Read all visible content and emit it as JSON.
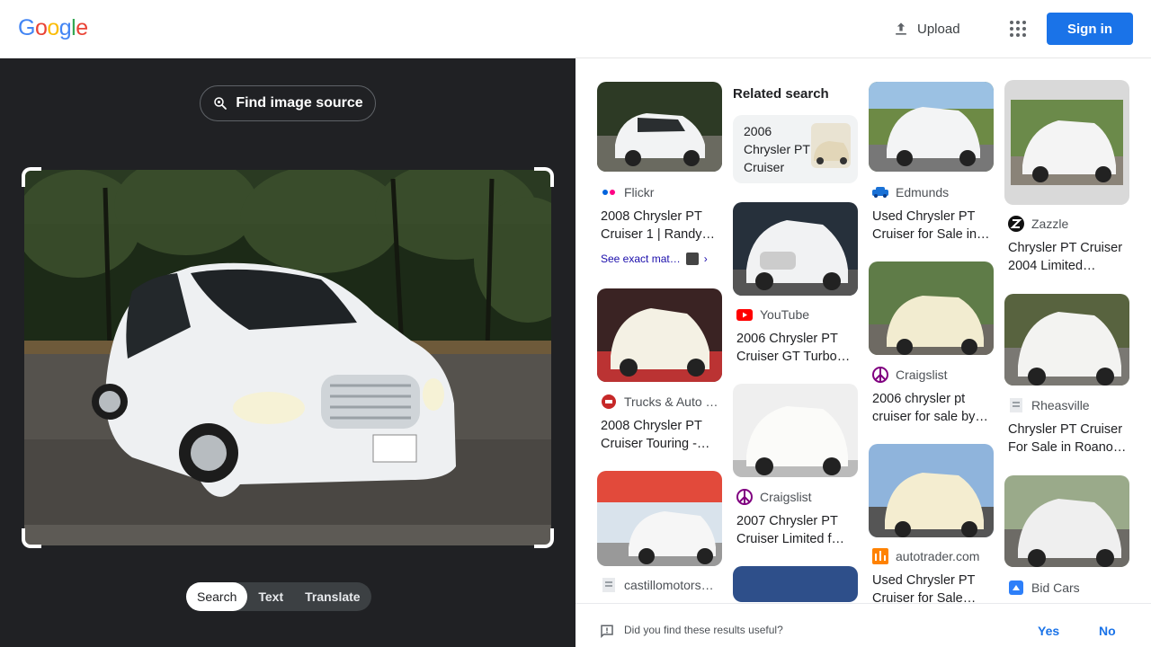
{
  "header": {
    "logo": [
      "G",
      "o",
      "o",
      "g",
      "l",
      "e"
    ],
    "logo_colors": [
      "#4285F4",
      "#EA4335",
      "#FBBC05",
      "#4285F4",
      "#34A853",
      "#EA4335"
    ],
    "upload_label": "Upload",
    "signin_label": "Sign in"
  },
  "lens": {
    "find_source_label": "Find image source",
    "modes": [
      "Search",
      "Text",
      "Translate"
    ],
    "active_mode": "Search"
  },
  "results": {
    "related_heading": "Related search",
    "related_query": "2006 Chrysler PT Cruiser",
    "items": [
      {
        "source": "Flickr",
        "title": "2008 Chrysler PT Cruiser 1 | Randy…",
        "icon": "flickr-icon"
      },
      {
        "source": "Trucks & Auto …",
        "title": "2008 Chrysler PT Cruiser Touring -…",
        "icon": "trucks-auto-icon"
      },
      {
        "source": "castillomotors…",
        "title": "",
        "icon": "castillo-icon"
      },
      {
        "source": "YouTube",
        "title": "2006 Chrysler PT Cruiser GT Turbo…",
        "icon": "youtube-icon"
      },
      {
        "source": "Craigslist",
        "title": "2007 Chrysler PT Cruiser Limited f…",
        "icon": "craigslist-icon"
      },
      {
        "source": "Edmunds",
        "title": "Used Chrysler PT Cruiser for Sale in…",
        "icon": "edmunds-icon"
      },
      {
        "source": "Craigslist",
        "title": "2006 chrysler pt cruiser for sale by…",
        "icon": "craigslist-icon"
      },
      {
        "source": "autotrader.com",
        "title": "Used Chrysler PT Cruiser for Sale…",
        "icon": "autotrader-icon"
      },
      {
        "source": "Zazzle",
        "title": "Chrysler PT Cruiser 2004 Limited…",
        "icon": "zazzle-icon"
      },
      {
        "source": "Rheasville",
        "title": "Chrysler PT Cruiser For Sale in Roano…",
        "icon": "rheasville-icon"
      },
      {
        "source": "Bid Cars",
        "title": "",
        "icon": "bidcars-icon"
      }
    ],
    "see_exact_label": "See exact mat…"
  },
  "feedback": {
    "question": "Did you find these results useful?",
    "yes": "Yes",
    "no": "No"
  }
}
